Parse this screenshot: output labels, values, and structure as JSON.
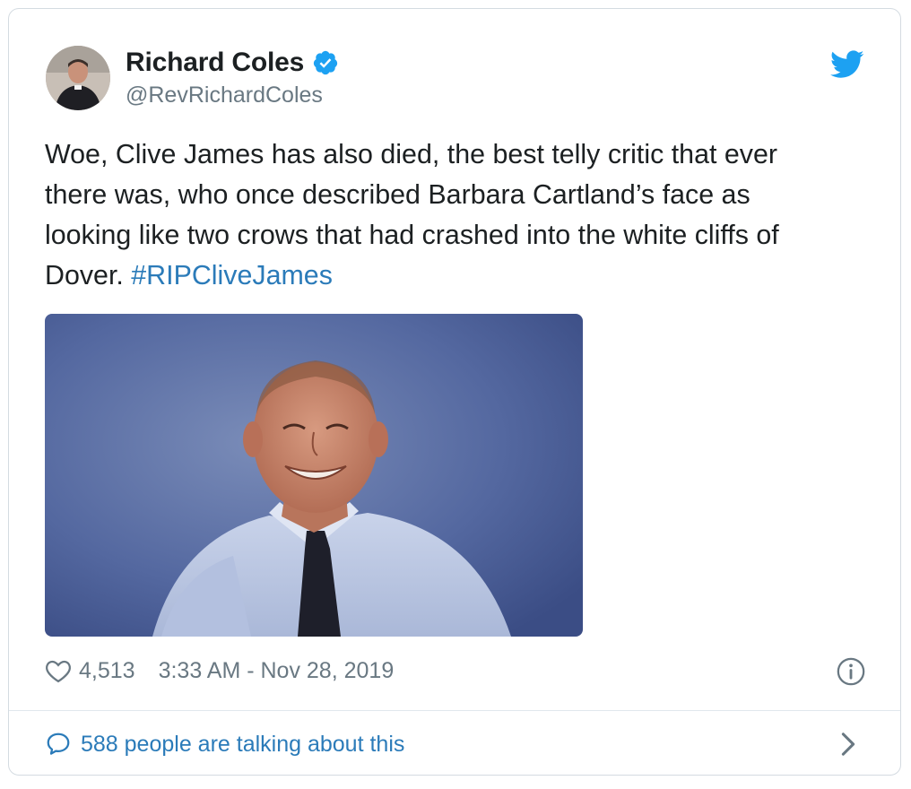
{
  "tweet": {
    "author": {
      "name": "Richard Coles",
      "handle": "@RevRichardColes",
      "verified_icon": "verified-badge-icon",
      "avatar": "avatar-photo"
    },
    "brand_icon": "twitter-bird-icon",
    "text_lines": {
      "line1": "Woe, Clive James has also died, the best telly critic that ever",
      "line2": "there was, who once described Barbara Cartland’s face as",
      "line3": "looking like two crows that had crashed into the white cliffs of",
      "line4": "Dover. ",
      "hashtag": "#RIPCliveJames"
    },
    "media": {
      "kind": "photo",
      "icon": "photo-portrait"
    },
    "meta": {
      "like_icon": "heart-icon",
      "likes": "4,513",
      "timestamp": "3:33 AM - Nov 28, 2019",
      "info_icon": "info-icon"
    },
    "footer": {
      "comment_icon": "comment-bubble-icon",
      "talking_label": "588 people are talking about this",
      "chevron_icon": "chevron-right-icon"
    }
  },
  "colors": {
    "text": "#1c2022",
    "secondary_text": "#697882",
    "link": "#2b7bb9",
    "twitter_blue": "#1da1f2",
    "border": "#d4dbe1"
  }
}
